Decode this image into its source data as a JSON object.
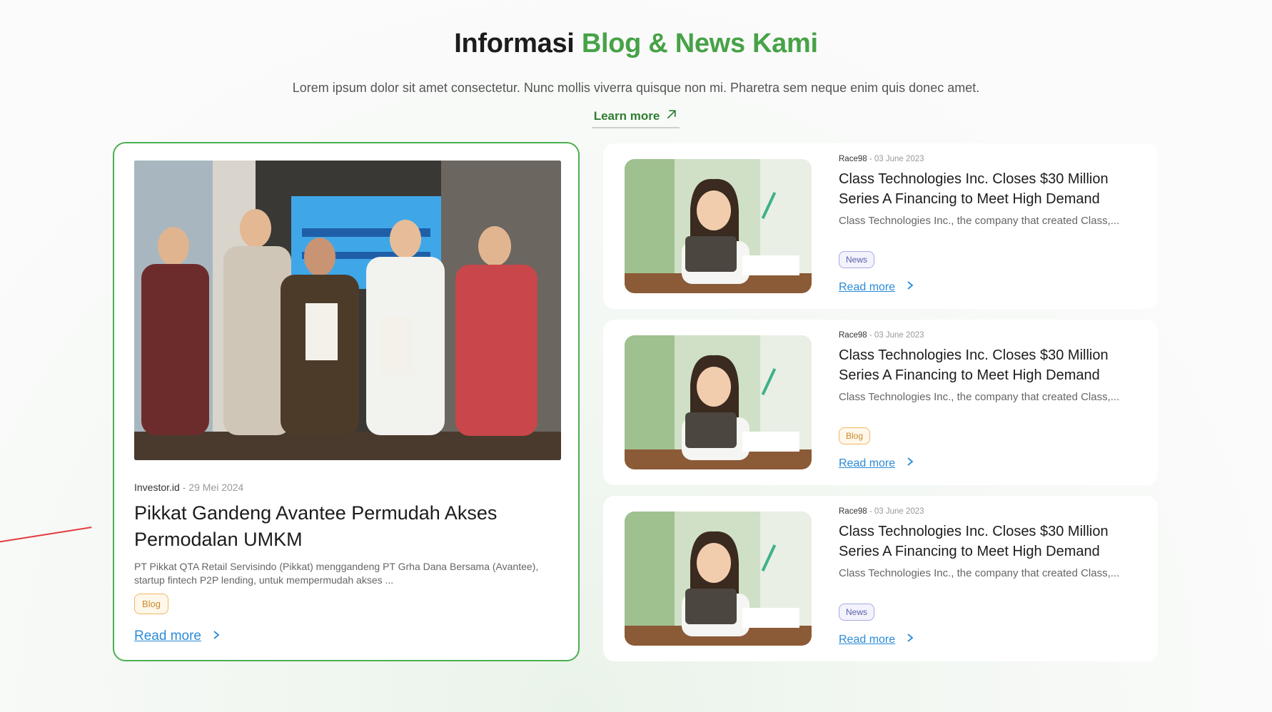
{
  "header": {
    "title_prefix": "Informasi",
    "title_accent": "Blog & News Kami",
    "subtitle": "Lorem ipsum dolor sit amet consectetur. Nunc mollis viverra quisque non mi. Pharetra sem neque enim quis donec amet.",
    "learn_more_label": "Learn more"
  },
  "featured": {
    "source": "Investor.id",
    "separator": " - ",
    "date": "29 Mei 2024",
    "title": "Pikkat Gandeng Avantee Permudah Akses Permodalan UMKM",
    "description": "PT Pikkat QTA Retail Servisindo (Pikkat) menggandeng PT Grha Dana Bersama (Avantee), startup fintech P2P lending, untuk mempermudah akses  ...",
    "tag": "Blog",
    "read_more": "Read more"
  },
  "articles": [
    {
      "source": "Race98",
      "separator": " - ",
      "date": "03 June 2023",
      "title": "Class Technologies Inc. Closes $30 Million Series A Financing to Meet High Demand",
      "description": "Class Technologies Inc., the company that created Class,...",
      "tag": "News",
      "read_more": "Read more"
    },
    {
      "source": "Race98",
      "separator": " - ",
      "date": "03 June 2023",
      "title": "Class Technologies Inc. Closes $30 Million Series A Financing to Meet High Demand",
      "description": "Class Technologies Inc., the company that created Class,...",
      "tag": "Blog",
      "read_more": "Read more"
    },
    {
      "source": "Race98",
      "separator": " - ",
      "date": "03 June 2023",
      "title": "Class Technologies Inc. Closes $30 Million Series A Financing to Meet High Demand",
      "description": "Class Technologies Inc., the company that created Class,...",
      "tag": "News",
      "read_more": "Read more"
    }
  ],
  "colors": {
    "accent_green": "#47a247",
    "link_blue": "#2a8bd8",
    "blog_tag": "#c98a2b",
    "news_tag": "#5a5fa8"
  },
  "icons": {
    "learn_more": "arrow-up-right-icon",
    "read_more": "chevron-right-icon"
  }
}
